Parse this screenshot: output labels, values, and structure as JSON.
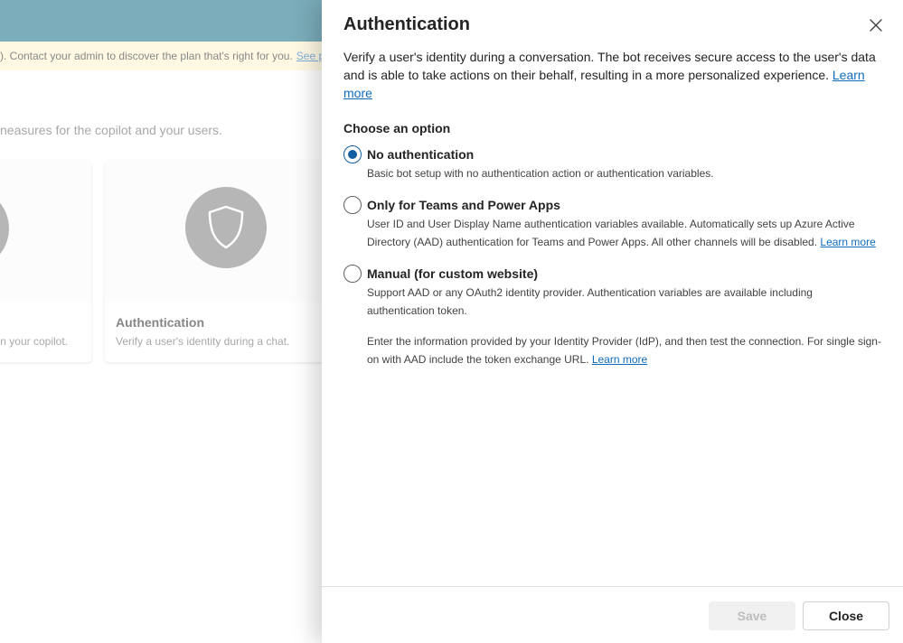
{
  "background": {
    "banner_text": "). Contact your admin to discover the plan that's right for you.",
    "banner_link": "See p",
    "description": "neasures for the copilot and your users.",
    "cards": [
      {
        "title": "",
        "subtitle": "n your copilot."
      },
      {
        "title": "Authentication",
        "subtitle": "Verify a user's identity during a chat."
      }
    ]
  },
  "panel": {
    "title": "Authentication",
    "description": "Verify a user's identity during a conversation. The bot receives secure access to the user's data and is able to take actions on their behalf, resulting in a more personalized experience.",
    "description_link": "Learn more",
    "section_label": "Choose an option",
    "options": [
      {
        "label": "No authentication",
        "selected": true,
        "description": "Basic bot setup with no authentication action or authentication variables."
      },
      {
        "label": "Only for Teams and Power Apps",
        "selected": false,
        "description": "User ID and User Display Name authentication variables available. Automatically sets up Azure Active Directory (AAD) authentication for Teams and Power Apps. All other channels will be disabled.",
        "link": "Learn more"
      },
      {
        "label": "Manual (for custom website)",
        "selected": false,
        "description": "Support AAD or any OAuth2 identity provider. Authentication variables are available including authentication token.",
        "description2": "Enter the information provided by your Identity Provider (IdP), and then test the connection. For single sign-on with AAD include the token exchange URL.",
        "link": "Learn more"
      }
    ],
    "buttons": {
      "save": "Save",
      "close": "Close"
    }
  },
  "colors": {
    "header": "#0f6a82",
    "banner": "#fff4ce",
    "link": "#0f6cbd",
    "radio_selected": "#115ea3"
  },
  "icons": {
    "close": "close-icon",
    "shield": "shield-icon",
    "card_icon": "circle-icon"
  }
}
